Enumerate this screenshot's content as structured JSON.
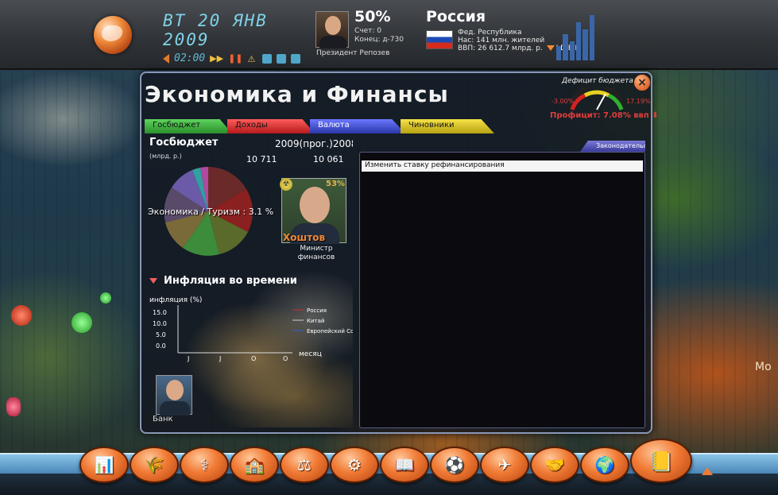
{
  "hud": {
    "date": "ВТ 20 ЯНВ 2009",
    "time": "02:00",
    "president": {
      "approval": "50%",
      "score": "Счет: 0",
      "term": "Конец: д-730",
      "name": "Президент Репозев"
    },
    "country": {
      "name": "Россия",
      "government": "Фед. Республика",
      "population": "Нас: 141 млн. жителей",
      "gdp": "ВВП: 26 612.7 млрд. р.",
      "idem": "I D E M"
    }
  },
  "panel": {
    "title": "Экономика и Финансы",
    "deficit_label": "Дефицит бюджета",
    "close": "×",
    "gauge_min": "-3.00%",
    "gauge_max": "17.19%",
    "profit": "Профицит: 7.08% ввп",
    "tabs": [
      "Госбюджет",
      "Доходы",
      "Валюта",
      "Чиновники"
    ],
    "budget": {
      "title": "Госбюджет",
      "unit": "(млрд. р.)",
      "years": "2009(прог.)2008",
      "value_2009": "10 711",
      "value_2008": "10 061",
      "pie_label": "Экономика / Туризм : 3.1 %"
    },
    "minister": {
      "score": "53%",
      "name": "Хоштов",
      "role": "Министр финансов",
      "emblem": "☢"
    },
    "inflation": {
      "title": "Инфляция во времени"
    },
    "bank_label": "Банк",
    "legislation_tab": "Законодательство",
    "law_items": [
      "Изменить ставку рефинансирования"
    ]
  },
  "map": {
    "edge_text": "Мо"
  },
  "colors": {
    "accent": "#f07a34",
    "panel_border": "#8a97b8",
    "hud_text": "#7fd2e8",
    "deficit_red": "#e03c3c"
  },
  "chart_data": {
    "type": "line",
    "title": "",
    "ylabel": "инфляция (%)",
    "xlabel": "месяц",
    "y_ticks": [
      15.0,
      10.0,
      5.0,
      0.0
    ],
    "x_ticks": [
      "J",
      "J",
      "O",
      "O"
    ],
    "ylim": [
      0,
      15
    ],
    "series": [
      {
        "name": "Россия",
        "values": [],
        "color": "#c83030"
      },
      {
        "name": "Китай",
        "values": [],
        "color": "#d0d0d0"
      },
      {
        "name": "Европейский Союз",
        "values": [],
        "color": "#3060c8"
      }
    ]
  }
}
